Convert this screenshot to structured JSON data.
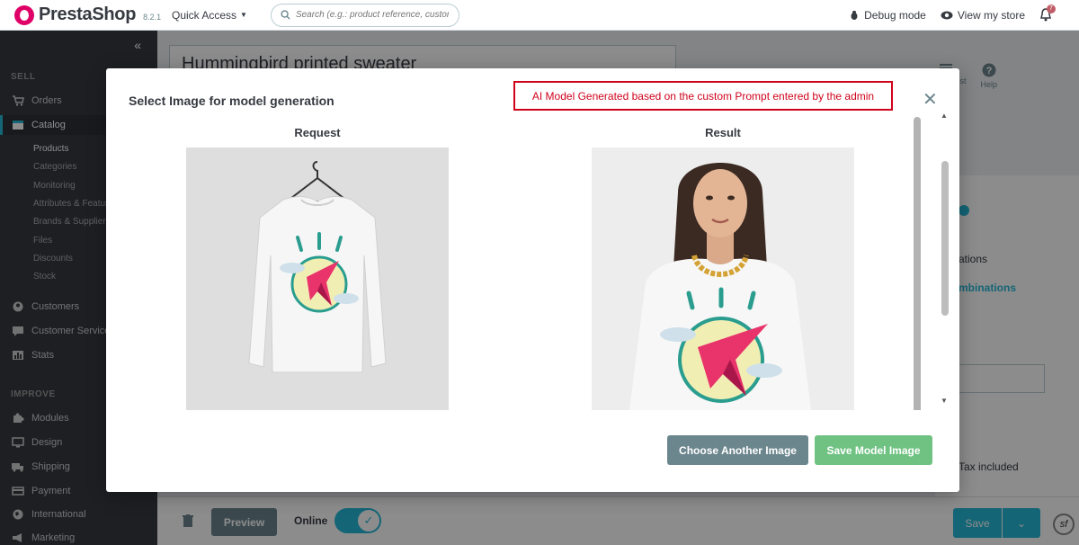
{
  "header": {
    "brand": "PrestaShop",
    "version": "8.2.1",
    "quick_access": "Quick Access",
    "search_placeholder": "Search (e.g.: product reference, custon",
    "debug_mode": "Debug mode",
    "view_store": "View my store",
    "notification_count": "7"
  },
  "sidebar": {
    "sell_label": "SELL",
    "improve_label": "IMPROVE",
    "items": [
      {
        "label": "Orders"
      },
      {
        "label": "Catalog"
      },
      {
        "label": "Customers"
      },
      {
        "label": "Customer Service"
      },
      {
        "label": "Stats"
      },
      {
        "label": "Modules"
      },
      {
        "label": "Design"
      },
      {
        "label": "Shipping"
      },
      {
        "label": "Payment"
      },
      {
        "label": "International"
      },
      {
        "label": "Marketing"
      }
    ],
    "catalog_sub": [
      "Products",
      "Categories",
      "Monitoring",
      "Attributes & Features",
      "Brands & Suppliers",
      "Files",
      "Discounts",
      "Stock"
    ]
  },
  "page": {
    "product_name": "Hummingbird printed sweater",
    "tools": [
      "Product list",
      "Help"
    ],
    "text_combinations": "ations",
    "link_combinations": "mbinations",
    "tax_included": "Tax included"
  },
  "bottom": {
    "preview": "Preview",
    "online": "Online",
    "save": "Save"
  },
  "modal": {
    "title": "Select Image for model generation",
    "notice": "AI Model Generated based on the custom Prompt entered by the admin",
    "request_label": "Request",
    "result_label": "Result",
    "choose_another": "Choose Another Image",
    "save_model": "Save Model Image"
  },
  "colors": {
    "brand_cyan": "#25b9d7",
    "sidebar_bg": "#363a41",
    "notice_red": "#d0021b",
    "save_green": "#70c283",
    "secondary": "#6c868e"
  }
}
